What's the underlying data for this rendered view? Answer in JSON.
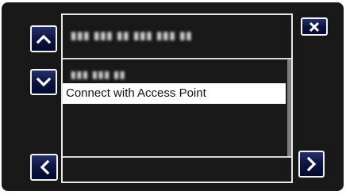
{
  "header": {
    "title": "▮▮▮ ▮▮▮ ▮▮ ▮▮▮ ▮▮▮ ▮▮"
  },
  "list": {
    "items": [
      {
        "label": "▮▮▮ ▮▮▮ ▮▮",
        "blurred": true
      },
      {
        "label": "Connect with Access Point",
        "selected": true
      }
    ],
    "scroll_position": 0.0
  },
  "buttons": {
    "up_icon": "chevron-up-icon",
    "down_icon": "chevron-down-icon",
    "back_icon": "chevron-left-icon",
    "next_icon": "chevron-right-icon",
    "close_icon": "close-icon"
  },
  "colors": {
    "panel_background": "#181818",
    "button_gradient_top": "#262f6a",
    "button_gradient_bottom": "#030a2e",
    "selection_background": "#ffffff"
  }
}
